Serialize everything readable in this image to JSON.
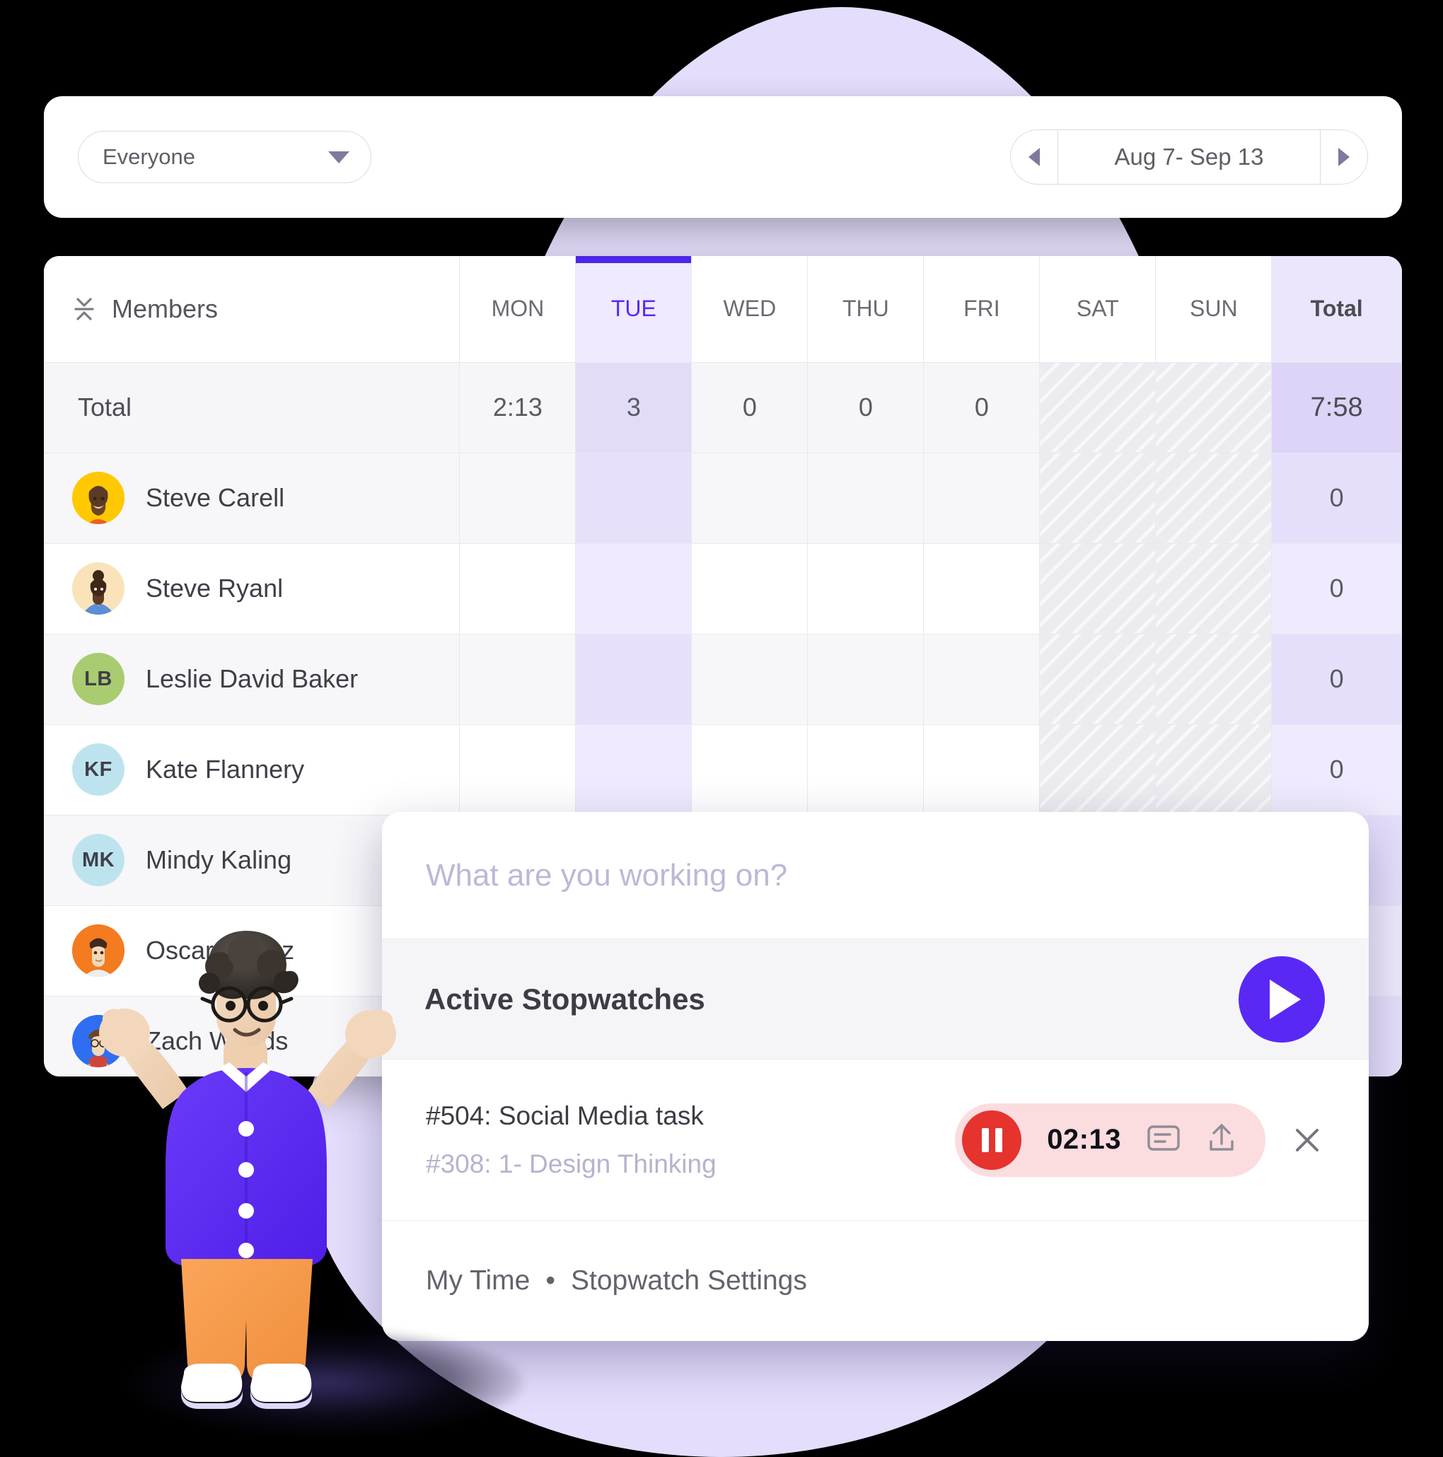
{
  "toolbar": {
    "member_filter": {
      "value": "Everyone",
      "icon": "chevron-down-icon"
    },
    "date_range": {
      "prev_icon": "triangle-left-icon",
      "label": "Aug 7- Sep 13",
      "next_icon": "triangle-right-icon"
    }
  },
  "grid": {
    "member_column_header": "Members",
    "collapse_icon": "collapse-rows-icon",
    "day_headers": [
      "MON",
      "TUE",
      "WED",
      "THU",
      "FRI",
      "SAT",
      "SUN"
    ],
    "total_header": "Total",
    "active_day": "TUE",
    "weekend_days": [
      "SAT",
      "SUN"
    ],
    "total_row": {
      "label": "Total",
      "days": [
        "2:13",
        "3",
        "0",
        "0",
        "0",
        "",
        ""
      ],
      "total": "7:58"
    },
    "members": [
      {
        "name": "Steve Carell",
        "avatar_type": "illustration",
        "avatar_color": "#ffc800",
        "initials": "",
        "days": [
          "",
          "",
          "",
          "",
          "",
          "",
          ""
        ],
        "total": "0"
      },
      {
        "name": "Steve Ryanl",
        "avatar_type": "illustration",
        "avatar_color": "#fae3bb",
        "initials": "",
        "days": [
          "",
          "",
          "",
          "",
          "",
          "",
          ""
        ],
        "total": "0"
      },
      {
        "name": "Leslie David Baker",
        "avatar_type": "initials",
        "avatar_color": "#a9cc70",
        "initials": "LB",
        "days": [
          "",
          "",
          "",
          "",
          "",
          "",
          ""
        ],
        "total": "0"
      },
      {
        "name": "Kate Flannery",
        "avatar_type": "initials",
        "avatar_color": "#bde4ee",
        "initials": "KF",
        "days": [
          "",
          "",
          "",
          "",
          "",
          "",
          ""
        ],
        "total": "0"
      },
      {
        "name": "Mindy Kaling",
        "avatar_type": "initials",
        "avatar_color": "#bde4ee",
        "initials": "MK",
        "days": [
          "",
          "",
          "",
          "",
          "",
          "",
          ""
        ],
        "total": ""
      },
      {
        "name": "Oscar Nunez",
        "avatar_type": "illustration",
        "avatar_color": "#f47b20",
        "initials": "",
        "days": [
          "",
          "",
          "",
          "",
          "",
          "",
          ""
        ],
        "total": ""
      },
      {
        "name": "Zach Woods",
        "avatar_type": "illustration",
        "avatar_color": "#2f6ef0",
        "initials": "",
        "days": [
          "",
          "",
          "",
          "",
          "",
          "",
          ""
        ],
        "total": ""
      }
    ]
  },
  "stopwatch_popup": {
    "task_input_placeholder": "What are you working on?",
    "section_title": "Active Stopwatches",
    "start_button_icon": "play-icon",
    "entry": {
      "title": "#504: Social Media  task",
      "subtitle": "#308: 1- Design Thinking",
      "pause_icon": "pause-icon",
      "elapsed": "02:13",
      "note_icon": "note-icon",
      "upload_icon": "upload-icon",
      "close_icon": "close-icon"
    },
    "footer": {
      "my_time": "My Time",
      "separator": "•",
      "settings": "Stopwatch Settings"
    }
  },
  "colors": {
    "accent_purple": "#5a28f5",
    "active_day_bar": "#4b26e8",
    "timer_red": "#e5332e",
    "timer_pill_bg": "#fbdcdf",
    "blob_lavender": "#e4ddfb",
    "total_col_bg": "#ece6fc"
  }
}
